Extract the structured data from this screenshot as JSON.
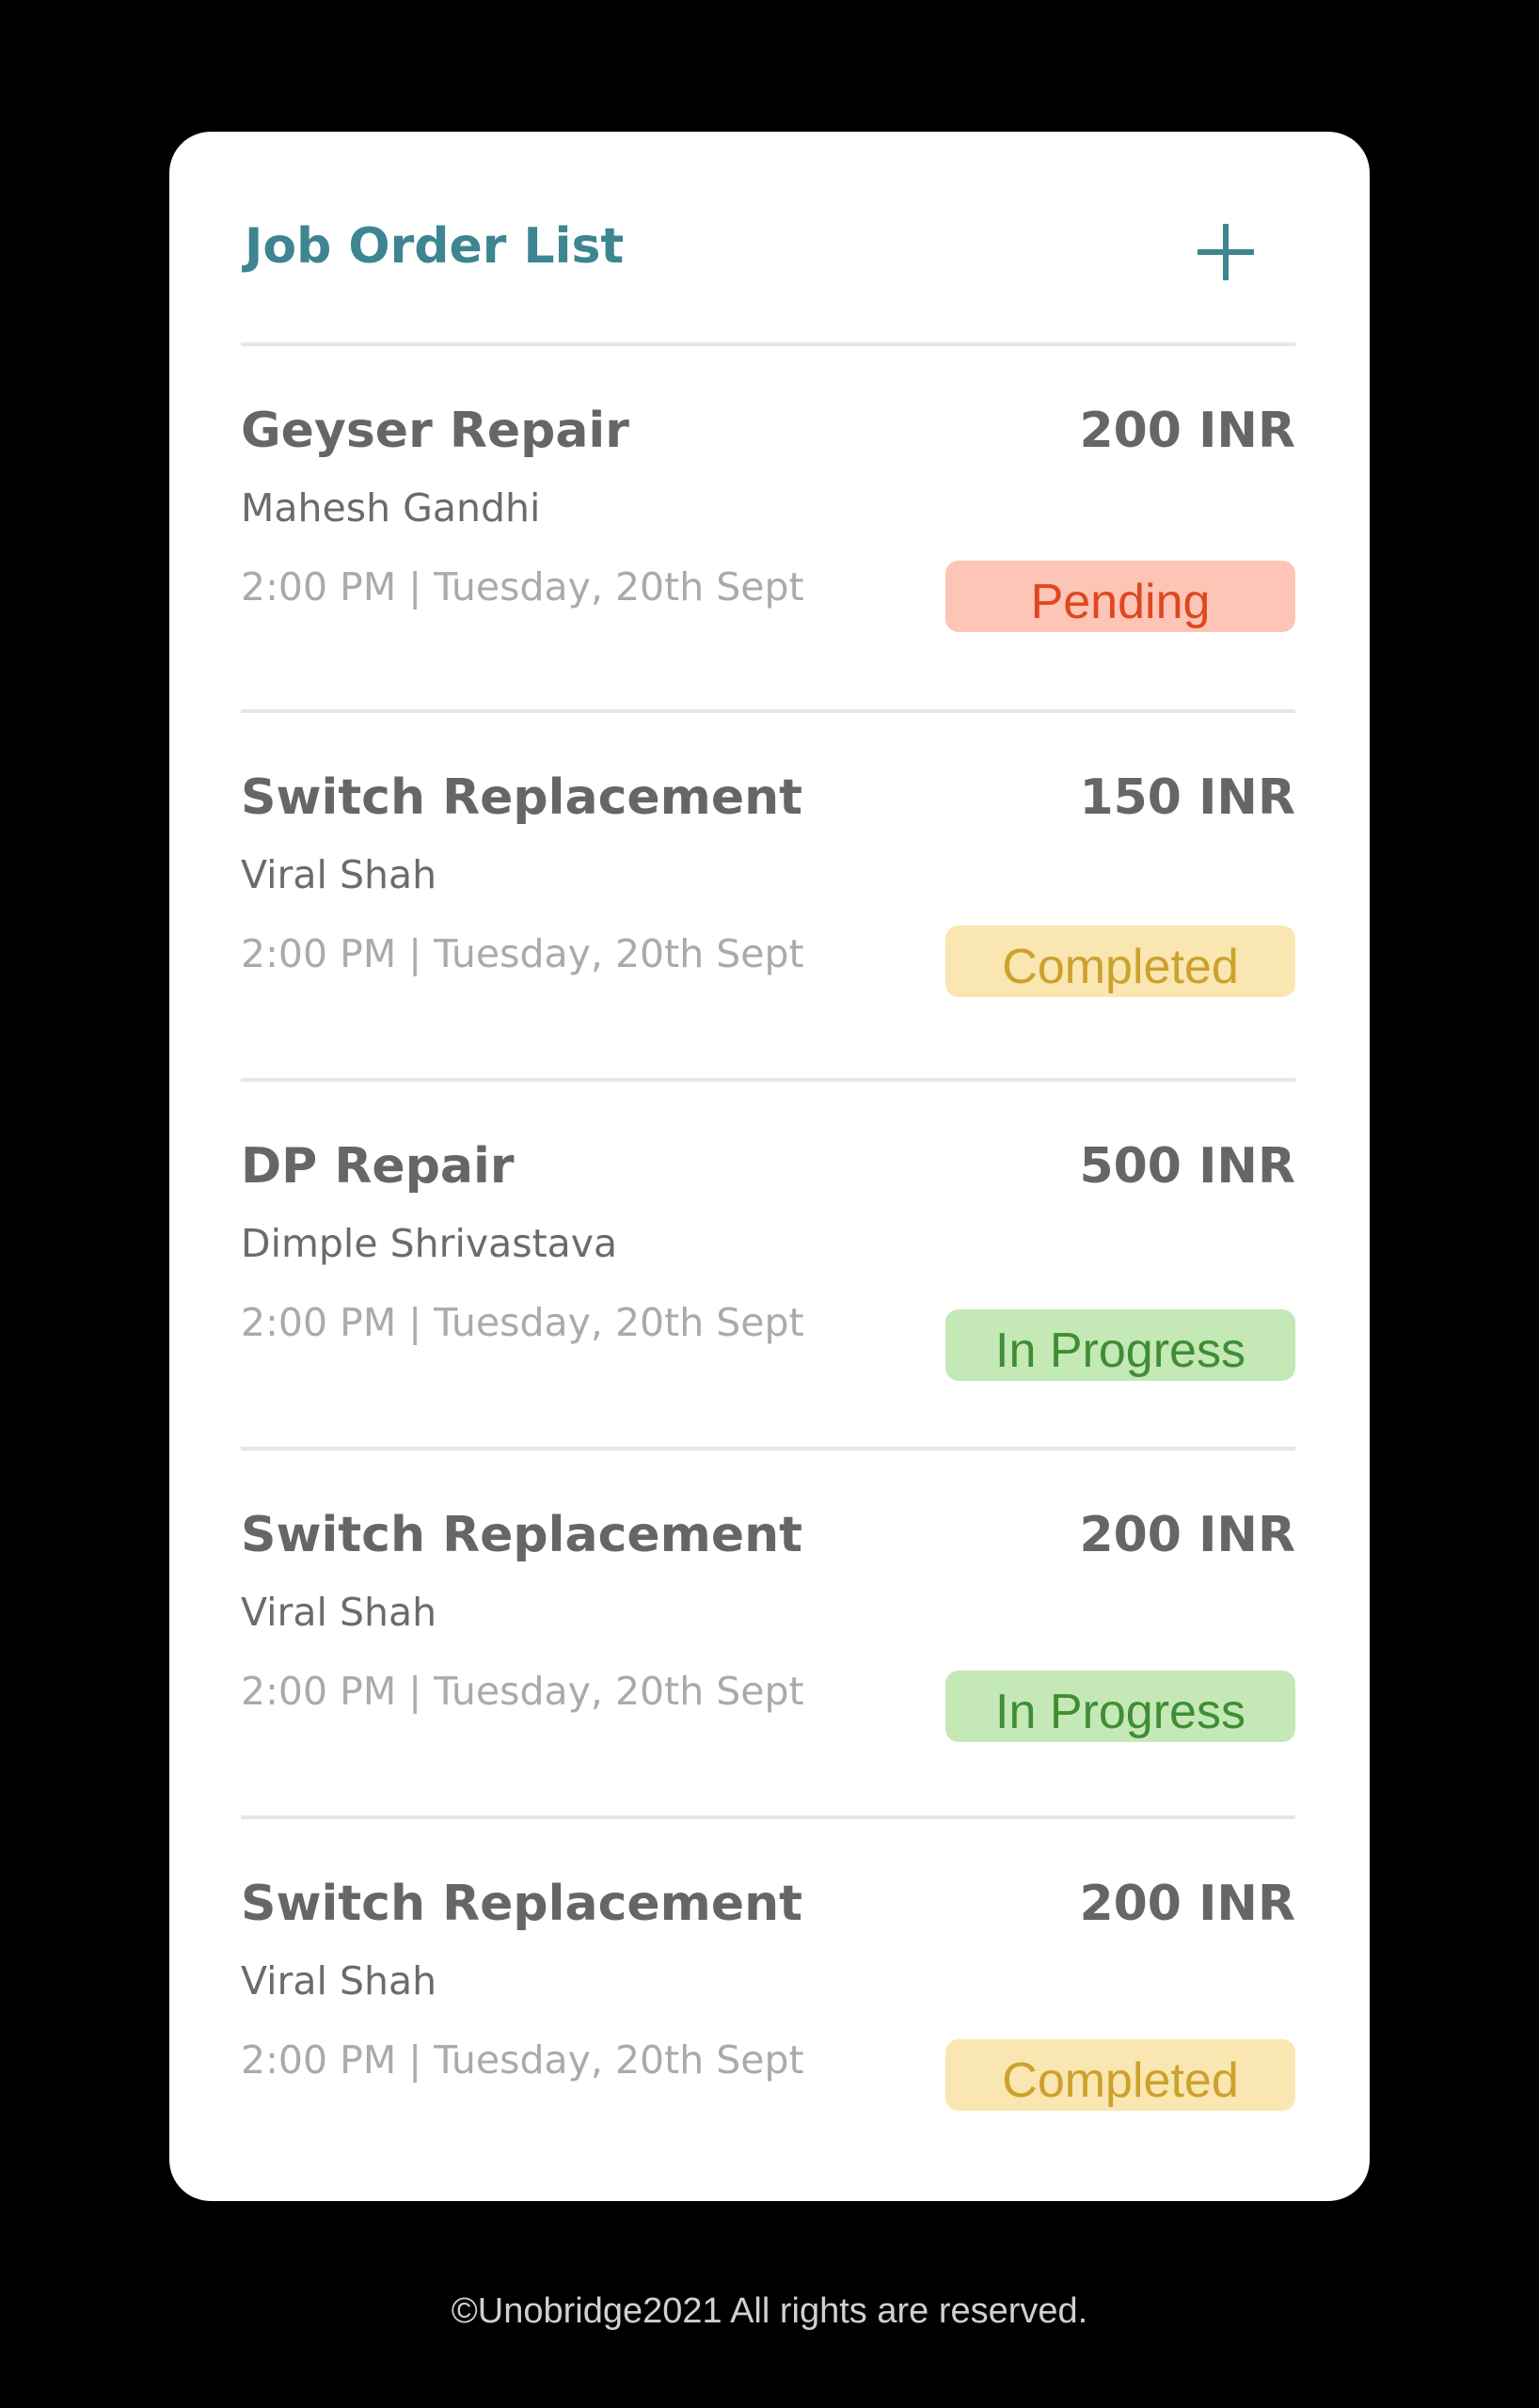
{
  "header": {
    "title": "Job Order List",
    "add_icon": "plus-icon",
    "accent_color": "#3d8590"
  },
  "jobs": [
    {
      "title": "Geyser Repair",
      "price": "200 INR",
      "customer": "Mahesh Gandhi",
      "time": "2:00 PM | Tuesday, 20th Sept",
      "status": "Pending",
      "status_bg": "#fcc5b5",
      "status_color": "#e0461f"
    },
    {
      "title": "Switch Replacement",
      "price": "150 INR",
      "customer": "Viral Shah",
      "time": "2:00 PM | Tuesday, 20th Sept",
      "status": "Completed",
      "status_bg": "#f9e6b0",
      "status_color": "#cca12c"
    },
    {
      "title": "DP Repair",
      "price": "500 INR",
      "customer": "Dimple Shrivastava",
      "time": "2:00 PM | Tuesday, 20th Sept",
      "status": "In Progress",
      "status_bg": "#c4e8b6",
      "status_color": "#3f8d35"
    },
    {
      "title": "Switch Replacement",
      "price": "200 INR",
      "customer": "Viral Shah",
      "time": "2:00 PM | Tuesday, 20th Sept",
      "status": "In Progress",
      "status_bg": "#c4e8b6",
      "status_color": "#3f8d35"
    },
    {
      "title": "Switch Replacement",
      "price": "200 INR",
      "customer": "Viral Shah",
      "time": "2:00 PM | Tuesday, 20th Sept",
      "status": "Completed",
      "status_bg": "#f9e6b0",
      "status_color": "#cca12c"
    }
  ],
  "footer": {
    "text": "©Unobridge2021 All rights are reserved."
  }
}
